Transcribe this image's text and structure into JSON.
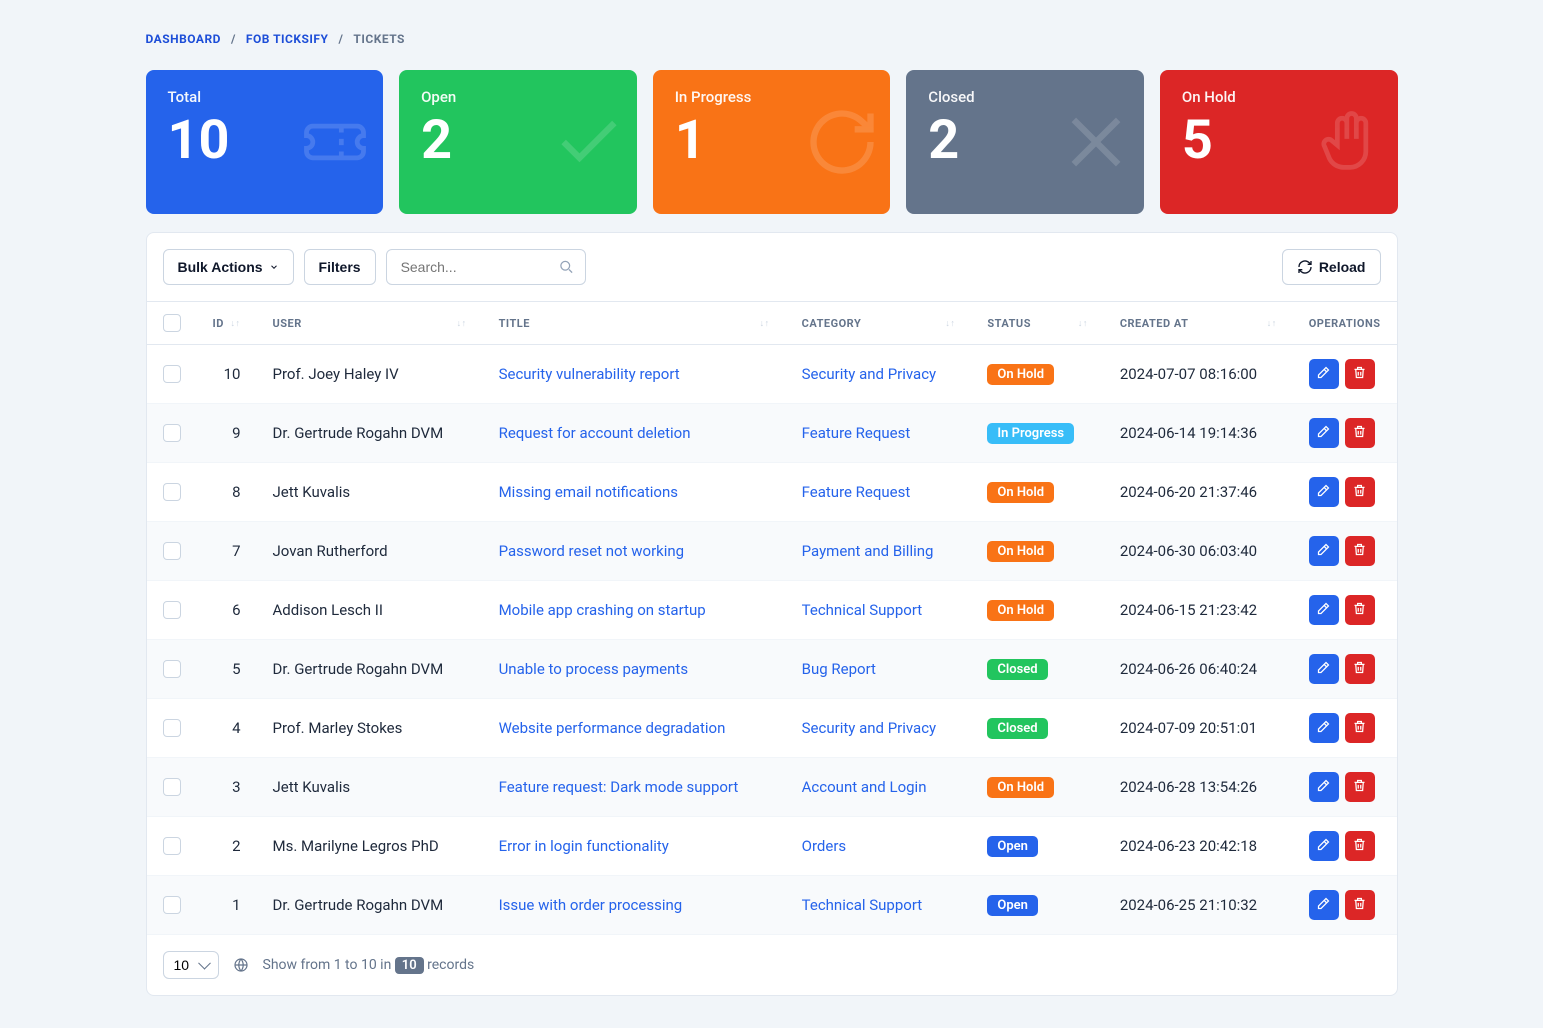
{
  "breadcrumb": {
    "items": [
      {
        "label": "DASHBOARD",
        "link": true
      },
      {
        "label": "FOB TICKSIFY",
        "link": true
      },
      {
        "label": "TICKETS",
        "link": false
      }
    ]
  },
  "stats": {
    "total": {
      "label": "Total",
      "value": "10"
    },
    "open": {
      "label": "Open",
      "value": "2"
    },
    "progress": {
      "label": "In Progress",
      "value": "1"
    },
    "closed": {
      "label": "Closed",
      "value": "2"
    },
    "hold": {
      "label": "On Hold",
      "value": "5"
    }
  },
  "toolbar": {
    "bulk": "Bulk Actions",
    "filters": "Filters",
    "search_placeholder": "Search...",
    "reload": "Reload"
  },
  "columns": {
    "id": "ID",
    "user": "USER",
    "title": "TITLE",
    "category": "CATEGORY",
    "status": "STATUS",
    "created_at": "CREATED AT",
    "operations": "OPERATIONS"
  },
  "status_labels": {
    "onhold": "On Hold",
    "inprogress": "In Progress",
    "closed": "Closed",
    "open": "Open"
  },
  "rows": [
    {
      "id": "10",
      "user": "Prof. Joey Haley IV",
      "title": "Security vulnerability report",
      "category": "Security and Privacy",
      "status": "onhold",
      "created_at": "2024-07-07 08:16:00"
    },
    {
      "id": "9",
      "user": "Dr. Gertrude Rogahn DVM",
      "title": "Request for account deletion",
      "category": "Feature Request",
      "status": "inprogress",
      "created_at": "2024-06-14 19:14:36"
    },
    {
      "id": "8",
      "user": "Jett Kuvalis",
      "title": "Missing email notifications",
      "category": "Feature Request",
      "status": "onhold",
      "created_at": "2024-06-20 21:37:46"
    },
    {
      "id": "7",
      "user": "Jovan Rutherford",
      "title": "Password reset not working",
      "category": "Payment and Billing",
      "status": "onhold",
      "created_at": "2024-06-30 06:03:40"
    },
    {
      "id": "6",
      "user": "Addison Lesch II",
      "title": "Mobile app crashing on startup",
      "category": "Technical Support",
      "status": "onhold",
      "created_at": "2024-06-15 21:23:42"
    },
    {
      "id": "5",
      "user": "Dr. Gertrude Rogahn DVM",
      "title": "Unable to process payments",
      "category": "Bug Report",
      "status": "closed",
      "created_at": "2024-06-26 06:40:24"
    },
    {
      "id": "4",
      "user": "Prof. Marley Stokes",
      "title": "Website performance degradation",
      "category": "Security and Privacy",
      "status": "closed",
      "created_at": "2024-07-09 20:51:01"
    },
    {
      "id": "3",
      "user": "Jett Kuvalis",
      "title": "Feature request: Dark mode support",
      "category": "Account and Login",
      "status": "onhold",
      "created_at": "2024-06-28 13:54:26"
    },
    {
      "id": "2",
      "user": "Ms. Marilyne Legros PhD",
      "title": "Error in login functionality",
      "category": "Orders",
      "status": "open",
      "created_at": "2024-06-23 20:42:18"
    },
    {
      "id": "1",
      "user": "Dr. Gertrude Rogahn DVM",
      "title": "Issue with order processing",
      "category": "Technical Support",
      "status": "open",
      "created_at": "2024-06-25 21:10:32"
    }
  ],
  "footer": {
    "pagesize": "10",
    "show_prefix": "Show from 1 to 10 in",
    "total_badge": "10",
    "show_suffix": "records"
  }
}
